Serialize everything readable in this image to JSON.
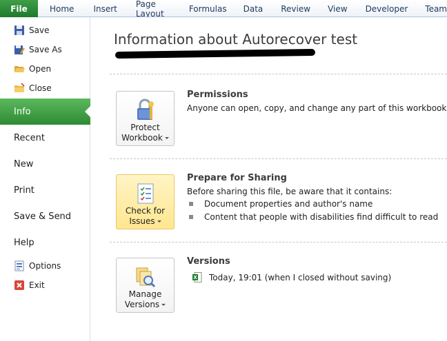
{
  "ribbon": {
    "file_tab": "File",
    "tabs": [
      "Home",
      "Insert",
      "Page Layout",
      "Formulas",
      "Data",
      "Review",
      "View",
      "Developer",
      "Team"
    ]
  },
  "nav": {
    "save": "Save",
    "save_as": "Save As",
    "open": "Open",
    "close": "Close",
    "info": "Info",
    "recent": "Recent",
    "new": "New",
    "print": "Print",
    "save_send": "Save & Send",
    "help": "Help",
    "options": "Options",
    "exit": "Exit"
  },
  "main": {
    "title": "Information about Autorecover test",
    "permissions": {
      "button_line1": "Protect",
      "button_line2": "Workbook",
      "heading": "Permissions",
      "text": "Anyone can open, copy, and change any part of this workbook."
    },
    "sharing": {
      "button_line1": "Check for",
      "button_line2": "Issues",
      "heading": "Prepare for Sharing",
      "text": "Before sharing this file, be aware that it contains:",
      "bullets": [
        "Document properties and author's name",
        "Content that people with disabilities find difficult to read"
      ]
    },
    "versions": {
      "button_line1": "Manage",
      "button_line2": "Versions",
      "heading": "Versions",
      "entry": "Today, 19:01 (when I closed without saving)"
    }
  },
  "colors": {
    "file_tab": "#2a8a35",
    "active_nav": "#3b9b41",
    "highlight_button": "#ffe690",
    "ribbon_text": "#1e395b"
  },
  "icons": {
    "save": "save-icon",
    "save_as": "save-as-icon",
    "open": "open-folder-icon",
    "close": "close-folder-icon",
    "options": "options-icon",
    "exit": "exit-icon",
    "protect": "lock-key-icon",
    "check": "checklist-icon",
    "versions": "versions-icon",
    "excel_file": "excel-file-icon"
  }
}
